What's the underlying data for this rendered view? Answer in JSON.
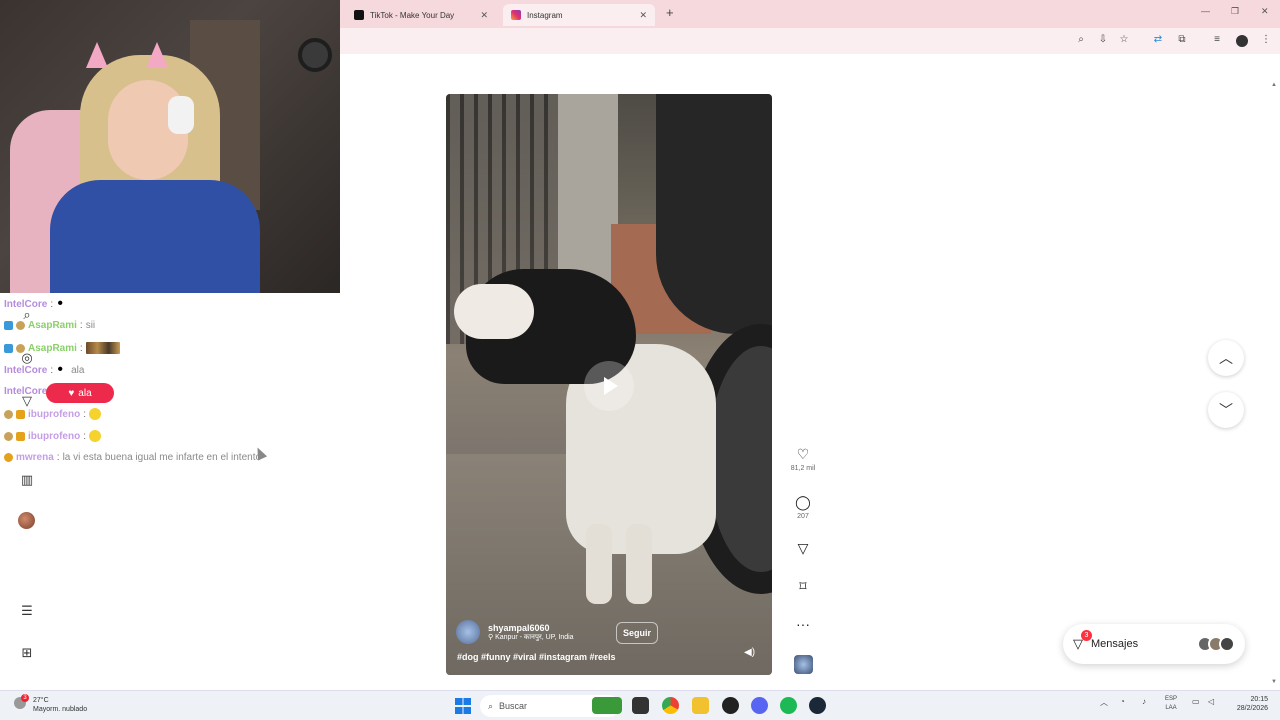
{
  "browser": {
    "tabs": [
      {
        "label": "TikTok - Make Your Day",
        "favicon_color": "#111111"
      },
      {
        "label": "Instagram",
        "favicon_color": "#e1306c"
      }
    ],
    "toolbar_icons": [
      "zoom-icon",
      "install-icon",
      "star-icon",
      "translate-icon",
      "extensions-icon",
      "media-icon",
      "profile-icon",
      "menu-icon"
    ]
  },
  "chat": {
    "lines": [
      {
        "name": "IntelCore",
        "sep": ":",
        "msg": "",
        "emote": "panda"
      },
      {
        "name": "AsapRami",
        "sep": ":",
        "msg": "sii",
        "emote": ""
      },
      {
        "name": "AsapRami",
        "sep": ":",
        "msg": "",
        "emote": "strip"
      },
      {
        "name": "IntelCore",
        "sep": ":",
        "msg": "ala",
        "emote": "panda"
      },
      {
        "name": "IntelCore",
        "sep": ":",
        "msg": "",
        "emote": ""
      },
      {
        "name": "ibuprofeno",
        "sep": ":",
        "msg": "",
        "emote": "smile"
      },
      {
        "name": "ibuprofeno",
        "sep": ":",
        "msg": "",
        "emote": "smile"
      },
      {
        "name": "mwrena",
        "sep": ":",
        "msg": "la vi esta buena igual me infarte en el intento",
        "emote": ""
      }
    ],
    "like_pill": "ala"
  },
  "reel": {
    "username": "shyampal6060",
    "location": "Kanpur - कानपुर, UP, India",
    "follow": "Seguir",
    "hashtags": "#dog #funny #viral #instagram #reels",
    "likes": "81,2 mil",
    "comments": "207"
  },
  "messages": {
    "label": "Mensajes",
    "badge": "3"
  },
  "taskbar": {
    "temp": "27°C",
    "weather": "Mayorm. nublado",
    "weather_badge": "3",
    "search": "Buscar",
    "lang1": "ESP",
    "lang2": "LAA",
    "time": "20:15",
    "date": "28/2/2026"
  }
}
